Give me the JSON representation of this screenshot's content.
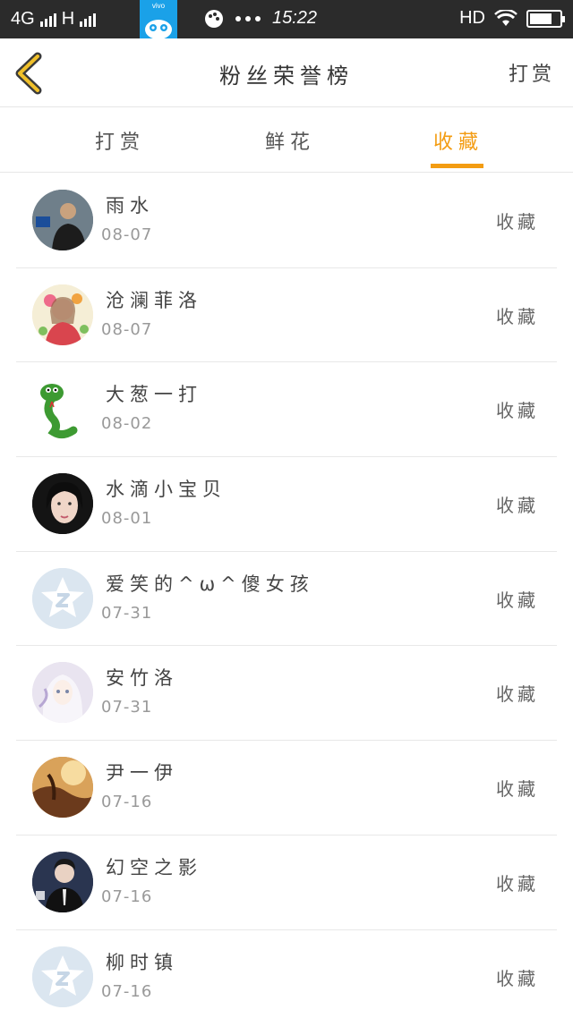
{
  "status_bar": {
    "network": "4G",
    "network2": "H",
    "carrier_badge": "vivo",
    "time": "15:22",
    "hd": "HD"
  },
  "header": {
    "title": "粉丝荣誉榜",
    "action": "打赏"
  },
  "tabs": [
    {
      "label": "打赏",
      "active": false
    },
    {
      "label": "鲜花",
      "active": false
    },
    {
      "label": "收藏",
      "active": true
    }
  ],
  "accent_color": "#f39c12",
  "rows": [
    {
      "name": "雨水",
      "date": "08-07",
      "action": "收藏",
      "avatar": "photo-man"
    },
    {
      "name": "沧澜菲洛",
      "date": "08-07",
      "action": "收藏",
      "avatar": "anime-girl"
    },
    {
      "name": "大葱一打",
      "date": "08-02",
      "action": "收藏",
      "avatar": "snake-cartoon"
    },
    {
      "name": "水滴小宝贝",
      "date": "08-01",
      "action": "收藏",
      "avatar": "photo-woman"
    },
    {
      "name": "爱笑的^ω^傻女孩",
      "date": "07-31",
      "action": "收藏",
      "avatar": "default-qzone"
    },
    {
      "name": "安竹洛",
      "date": "07-31",
      "action": "收藏",
      "avatar": "anime-white"
    },
    {
      "name": "尹一伊",
      "date": "07-16",
      "action": "收藏",
      "avatar": "golden-art"
    },
    {
      "name": "幻空之影",
      "date": "07-16",
      "action": "收藏",
      "avatar": "photo-suit"
    },
    {
      "name": "柳时镇",
      "date": "07-16",
      "action": "收藏",
      "avatar": "default-qzone"
    }
  ]
}
